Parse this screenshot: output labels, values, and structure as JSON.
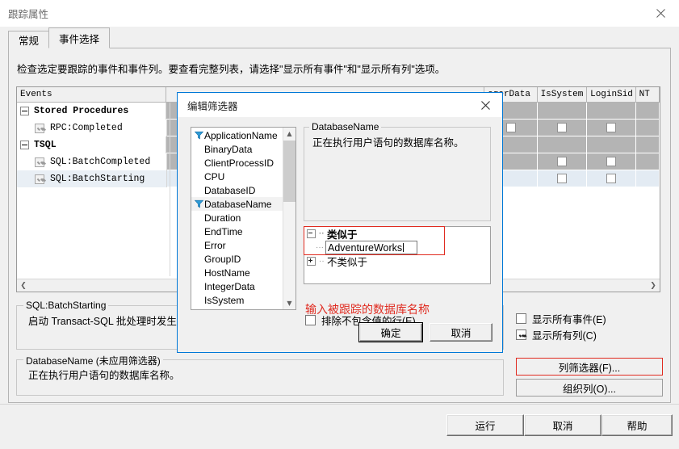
{
  "window": {
    "title": "跟踪属性",
    "close_icon": "close-icon"
  },
  "tabs": [
    {
      "label": "常规",
      "selected": false
    },
    {
      "label": "事件选择",
      "selected": true
    }
  ],
  "description": "检查选定要跟踪的事件和事件列。要查看完整列表，请选择\"显示所有事件\"和\"显示所有列\"选项。",
  "grid": {
    "columns": [
      "Events",
      "egerData",
      "IsSystem",
      "LoginSid",
      "NT"
    ],
    "rows": [
      {
        "name": "Stored Procedures",
        "type": "group",
        "expanded": true
      },
      {
        "name": "RPC:Completed",
        "type": "event",
        "checked": true
      },
      {
        "name": "TSQL",
        "type": "group",
        "expanded": true
      },
      {
        "name": "SQL:BatchCompleted",
        "type": "event",
        "checked": true
      },
      {
        "name": "SQL:BatchStarting",
        "type": "event",
        "checked": true,
        "selected": true
      }
    ],
    "scroll_left_icon": "chevron-left-icon",
    "scroll_right_icon": "chevron-right-icon"
  },
  "event_info": {
    "legend": "SQL:BatchStarting",
    "text": "启动 Transact-SQL 批处理时发生。"
  },
  "column_info": {
    "legend": "DatabaseName (未应用筛选器)",
    "text": "正在执行用户语句的数据库名称。"
  },
  "options": {
    "show_all_events": {
      "label": "显示所有事件(E)",
      "checked": false
    },
    "show_all_columns": {
      "label": "显示所有列(C)",
      "checked": true
    },
    "column_filters_button": "列筛选器(F)...",
    "organize_columns_button": "组织列(O)..."
  },
  "footer": {
    "run_button": "运行",
    "cancel_button": "取消",
    "help_button": "帮助"
  },
  "dialog": {
    "title": "编辑筛选器",
    "close_icon": "close-icon",
    "columns": [
      {
        "label": "ApplicationName",
        "filtered": true,
        "selected": false
      },
      {
        "label": "BinaryData",
        "filtered": false,
        "selected": false
      },
      {
        "label": "ClientProcessID",
        "filtered": false,
        "selected": false
      },
      {
        "label": "CPU",
        "filtered": false,
        "selected": false
      },
      {
        "label": "DatabaseID",
        "filtered": false,
        "selected": false
      },
      {
        "label": "DatabaseName",
        "filtered": true,
        "selected": true
      },
      {
        "label": "Duration",
        "filtered": false,
        "selected": false
      },
      {
        "label": "EndTime",
        "filtered": false,
        "selected": false
      },
      {
        "label": "Error",
        "filtered": false,
        "selected": false
      },
      {
        "label": "GroupID",
        "filtered": false,
        "selected": false
      },
      {
        "label": "HostName",
        "filtered": false,
        "selected": false
      },
      {
        "label": "IntegerData",
        "filtered": false,
        "selected": false
      },
      {
        "label": "IsSystem",
        "filtered": false,
        "selected": false
      }
    ],
    "description": {
      "legend": "DatabaseName",
      "text": "正在执行用户语句的数据库名称。"
    },
    "hint": "输入被跟踪的数据库名称",
    "tree": {
      "like_label": "类似于",
      "like_value": "AdventureWorks",
      "notlike_label": "不类似于"
    },
    "exclude_checkbox": {
      "label": "排除不包含值的行(E)",
      "checked": false
    },
    "ok_button": "确定",
    "cancel_button": "取消"
  }
}
